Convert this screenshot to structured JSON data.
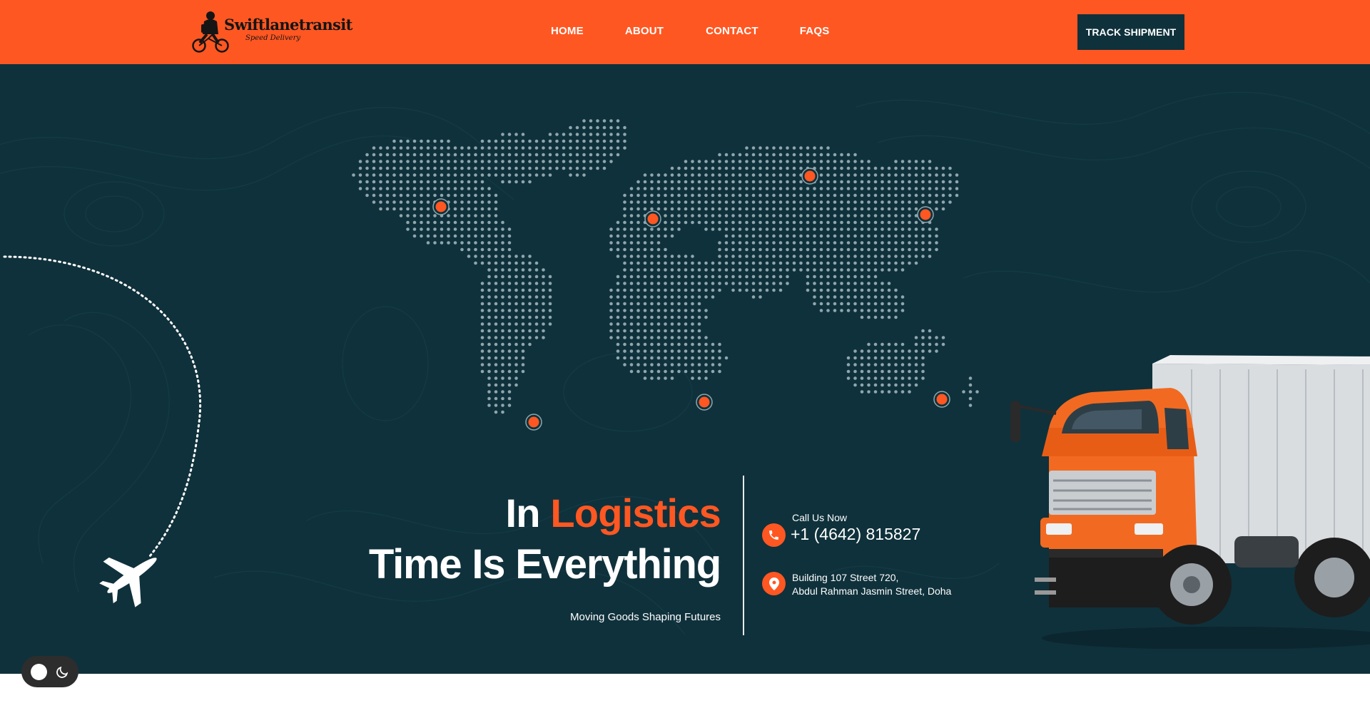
{
  "brand": {
    "name": "Swiftlanetransit",
    "tagline": "Speed Delivery"
  },
  "nav": {
    "items": [
      {
        "label": "HOME"
      },
      {
        "label": "ABOUT"
      },
      {
        "label": "CONTACT"
      },
      {
        "label": "FAQS"
      }
    ],
    "cta_label": "TRACK SHIPMENT"
  },
  "hero": {
    "headline_part1": "In",
    "headline_accent": "Logistics",
    "headline_line2": "Time Is Everything",
    "subheadline": "Moving Goods Shaping Futures"
  },
  "contact": {
    "call_label": "Call Us Now",
    "phone": "+1 (4642) 815827",
    "address_line1": "Building 107 Street 720,",
    "address_line2": "Abdul Rahman Jasmin Street, Doha"
  },
  "icons": {
    "phone": "phone-icon",
    "location": "map-pin-icon",
    "plane": "airplane-icon",
    "theme_dark": "moon-icon",
    "theme_light": "sun-circle-icon"
  },
  "colors": {
    "brand_orange": "#ff5722",
    "dark_teal": "#0f313b",
    "white": "#ffffff"
  }
}
